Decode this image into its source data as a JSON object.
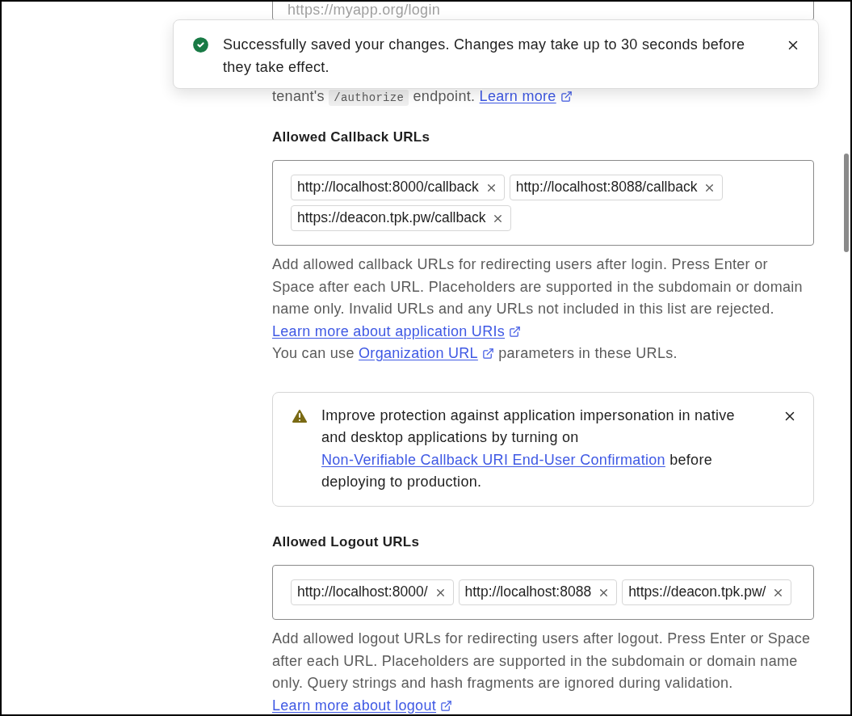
{
  "redirect_field": {
    "placeholder": "https://myapp.org/login"
  },
  "redirect_help": {
    "before": "tenant's",
    "code": "/authorize",
    "after": "endpoint.",
    "link": "Learn more"
  },
  "callback": {
    "label": "Allowed Callback URLs",
    "tags": [
      "http://localhost:8000/callback",
      "http://localhost:8088/callback",
      "https://deacon.tpk.pw/callback"
    ],
    "help": "Add allowed callback URLs for redirecting users after login. Press Enter or Space after each URL. Placeholders are supported in the subdomain or domain name only. Invalid URLs and any URLs not included in this list are rejected.",
    "link": "Learn more about application URIs",
    "org_before": "You can use",
    "org_link": "Organization URL",
    "org_after": "parameters in these URLs."
  },
  "alert": {
    "before": "Improve protection against application impersonation in native and desktop applications by turning on",
    "link": "Non-Verifiable Callback URI End-User Confirmation",
    "after": "before deploying to production."
  },
  "logout": {
    "label": "Allowed Logout URLs",
    "tags": [
      "http://localhost:8000/",
      "http://localhost:8088",
      "https://deacon.tpk.pw/"
    ],
    "help": "Add allowed logout URLs for redirecting users after logout. Press Enter or Space after each URL. Placeholders are supported in the subdomain or domain name only. Query strings and hash fragments are ignored during validation.",
    "link": "Learn more about logout"
  },
  "toast": {
    "message": "Successfully saved your changes. Changes may take up to 30 seconds before they take effect."
  }
}
